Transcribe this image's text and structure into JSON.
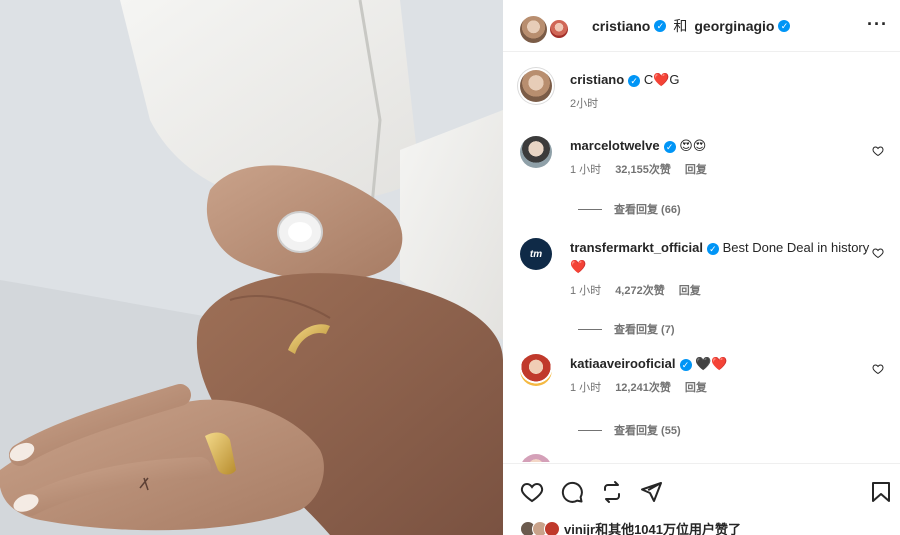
{
  "header": {
    "user1": "cristiano",
    "separator": "和",
    "user2": "georginagio",
    "more_icon": "more-horizontal-icon"
  },
  "caption": {
    "user": "cristiano",
    "text": "C❤️G",
    "time": "2小时"
  },
  "comments": [
    {
      "user": "marcelotwelve",
      "text": "😍😍",
      "time": "1 小时",
      "likes": "32,155次赞",
      "reply": "回复",
      "view_replies": "查看回复 (66)"
    },
    {
      "user": "transfermarkt_official",
      "text": "Best Done Deal in history ❤️",
      "time": "1 小时",
      "likes": "4,272次赞",
      "reply": "回复",
      "view_replies": "查看回复 (7)"
    },
    {
      "user": "katiaaveirooficial",
      "text": "🖤❤️",
      "time": "1 小时",
      "likes": "12,241次赞",
      "reply": "回复",
      "view_replies": "查看回复 (55)"
    }
  ],
  "liked_by": {
    "user": "vinijr",
    "rest": "和其他1041万位用户赞了"
  },
  "colors": {
    "verified": "#0095f6",
    "heart": "#ed4956",
    "muted_text": "#737373"
  }
}
